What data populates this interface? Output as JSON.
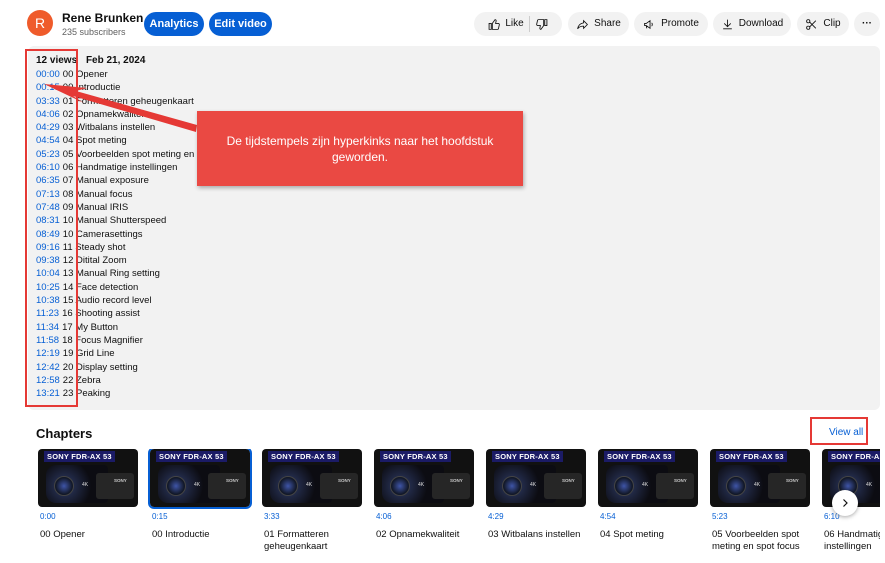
{
  "header": {
    "avatar_letter": "R",
    "channel_name": "Rene Brunken",
    "subscribers": "235 subscribers",
    "analytics_label": "Analytics",
    "edit_label": "Edit video",
    "like_label": "Like",
    "share_label": "Share",
    "promote_label": "Promote",
    "download_label": "Download",
    "clip_label": "Clip",
    "more_label": "···"
  },
  "description": {
    "views": "12 views",
    "date": "Feb 21, 2024",
    "timestamps": [
      {
        "time": "00:00",
        "label": "00 Opener"
      },
      {
        "time": "00:15",
        "label": "00 Introductie"
      },
      {
        "time": "03:33",
        "label": "01 Formatteren geheugenkaart"
      },
      {
        "time": "04:06",
        "label": "02 Opnamekwaliteit"
      },
      {
        "time": "04:29",
        "label": "03 Witbalans instellen"
      },
      {
        "time": "04:54",
        "label": "04 Spot meting"
      },
      {
        "time": "05:23",
        "label": "05 Voorbeelden spot meting en spot focus"
      },
      {
        "time": "06:10",
        "label": "06 Handmatige instellingen"
      },
      {
        "time": "06:35",
        "label": "07 Manual exposure"
      },
      {
        "time": "07:13",
        "label": "08 Manual focus"
      },
      {
        "time": "07:48",
        "label": "09 Manual IRIS"
      },
      {
        "time": "08:31",
        "label": "10 Manual Shutterspeed"
      },
      {
        "time": "08:49",
        "label": "10 Camerasettings"
      },
      {
        "time": "09:16",
        "label": "11 Steady shot"
      },
      {
        "time": "09:38",
        "label": "12 Ditital Zoom"
      },
      {
        "time": "10:04",
        "label": "13 Manual Ring setting"
      },
      {
        "time": "10:25",
        "label": "14 Face detection"
      },
      {
        "time": "10:38",
        "label": "15 Audio record level"
      },
      {
        "time": "11:23",
        "label": "16 Shooting assist"
      },
      {
        "time": "11:34",
        "label": "17 My Button"
      },
      {
        "time": "11:58",
        "label": "18 Focus Magnifier"
      },
      {
        "time": "12:19",
        "label": "19 Grid Line"
      },
      {
        "time": "12:42",
        "label": "20 Display setting"
      },
      {
        "time": "12:58",
        "label": "22 Zebra"
      },
      {
        "time": "13:21",
        "label": "23 Peaking"
      }
    ]
  },
  "annotation": {
    "callout_text": "De tijdstempels zijn hyperkinks naar het hoofdstuk geworden."
  },
  "chapters": {
    "title": "Chapters",
    "view_all": "View all",
    "thumb_brand": "SONY FDR-AX 53",
    "thumb_sony": "SONY",
    "thumb_4k": "4K",
    "items": [
      {
        "time": "0:00",
        "title": "00 Opener"
      },
      {
        "time": "0:15",
        "title": "00 Introductie"
      },
      {
        "time": "3:33",
        "title": "01 Formatteren geheugenkaart"
      },
      {
        "time": "4:06",
        "title": "02 Opnamekwaliteit"
      },
      {
        "time": "4:29",
        "title": "03 Witbalans instellen"
      },
      {
        "time": "4:54",
        "title": "04 Spot meting"
      },
      {
        "time": "5:23",
        "title": "05 Voorbeelden spot meting en spot focus"
      },
      {
        "time": "6:10",
        "title": "06 Handmatige instellingen"
      }
    ]
  },
  "colors": {
    "link": "#065fd4",
    "annotation": "#e53935"
  }
}
